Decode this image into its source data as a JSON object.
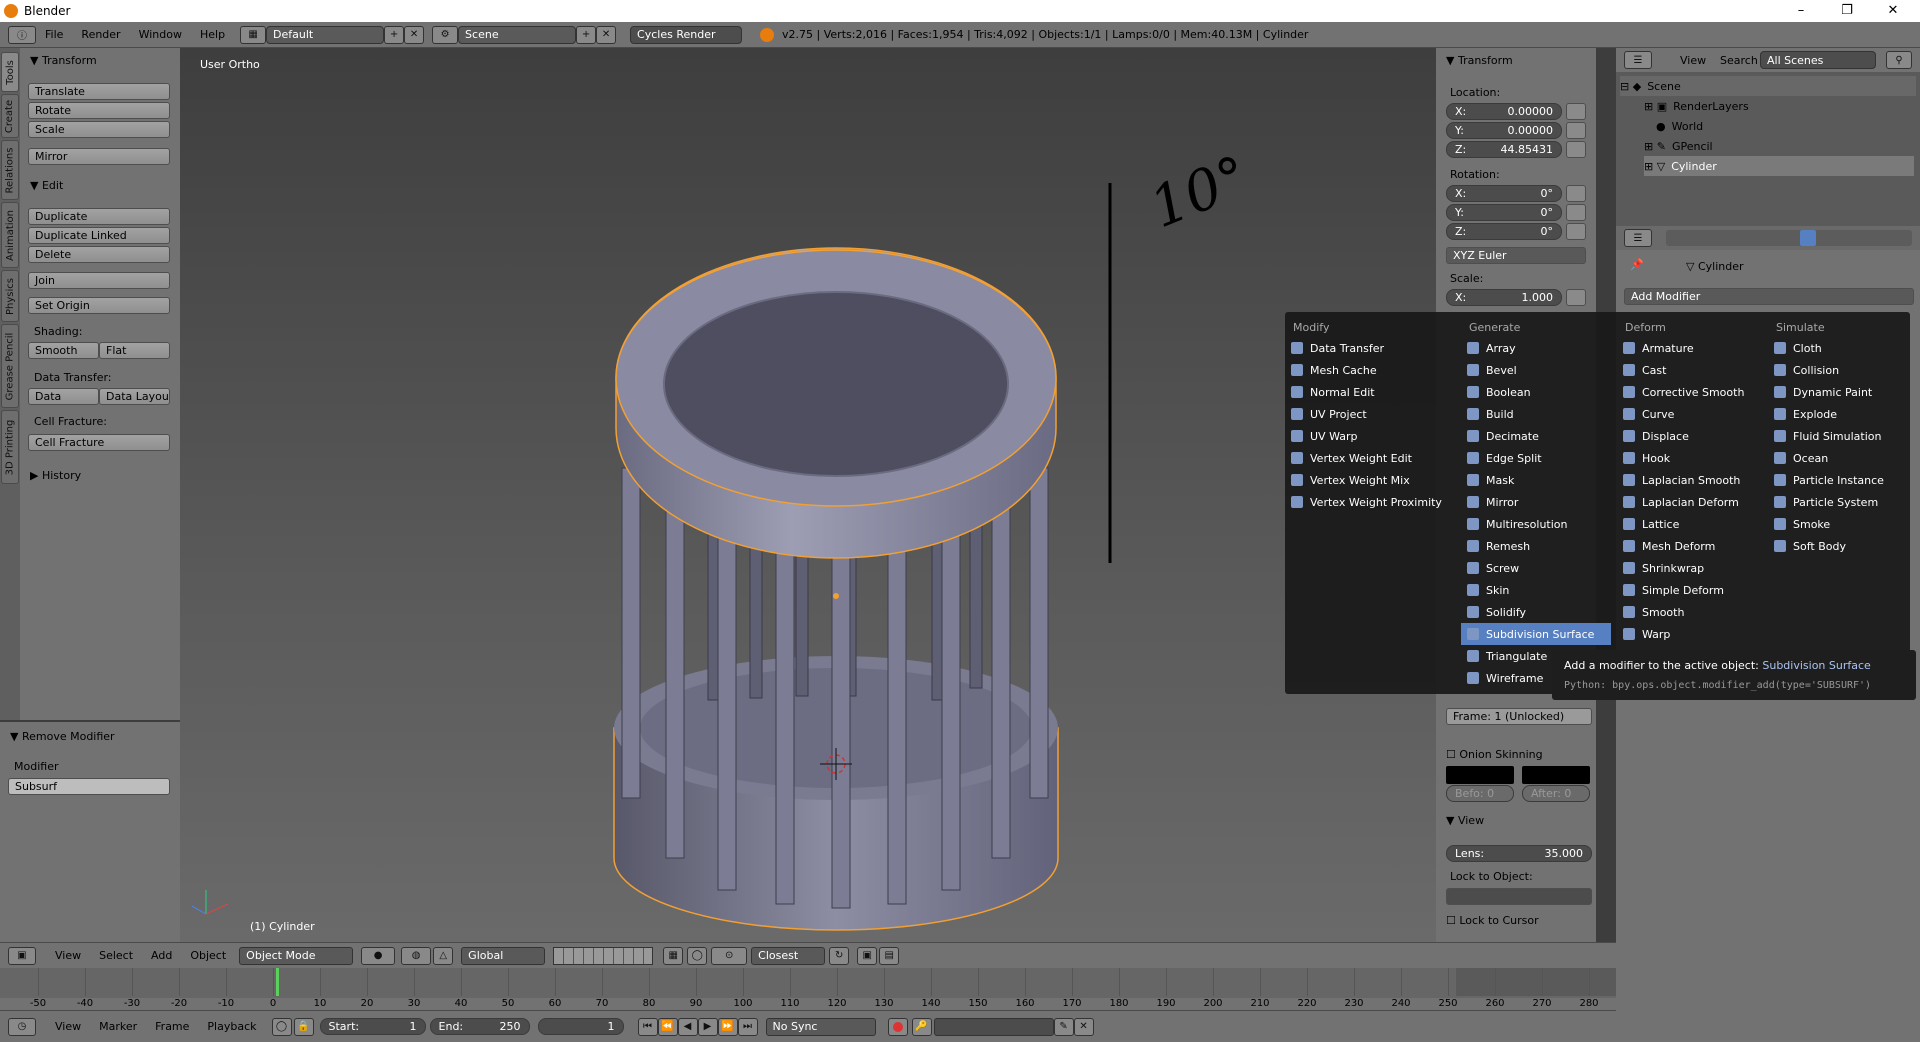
{
  "window": {
    "title": "Blender"
  },
  "topbar": {
    "menus": [
      "File",
      "Render",
      "Window",
      "Help"
    ],
    "layout": "Default",
    "scene": "Scene",
    "engine": "Cycles Render",
    "stats": "v2.75 | Verts:2,016 | Faces:1,954 | Tris:4,092 | Objects:1/1 | Lamps:0/0 | Mem:40.13M | Cylinder"
  },
  "vtabs": [
    "Tools",
    "Create",
    "Relations",
    "Animation",
    "Physics",
    "Grease Pencil",
    "3D Printing"
  ],
  "toolshelf": {
    "transform": {
      "title": "Transform",
      "buttons": [
        "Translate",
        "Rotate",
        "Scale",
        "Mirror"
      ]
    },
    "edit": {
      "title": "Edit",
      "buttons": [
        "Duplicate",
        "Duplicate Linked",
        "Delete",
        "Join",
        "Set Origin"
      ],
      "shading_label": "Shading:",
      "smooth": "Smooth",
      "flat": "Flat",
      "data_transfer_label": "Data Transfer:",
      "data": "Data",
      "data_layout": "Data Layout",
      "cell_fracture_label": "Cell Fracture:",
      "cell_fracture": "Cell Fracture"
    },
    "history": "History"
  },
  "operator": {
    "title": "Remove Modifier",
    "modifier_label": "Modifier",
    "modifier_value": "Subsurf"
  },
  "viewport": {
    "view_name": "User Ortho",
    "object_name": "(1) Cylinder"
  },
  "npanel": {
    "transform": "Transform",
    "location": "Location:",
    "loc": [
      {
        "a": "X:",
        "v": "0.00000"
      },
      {
        "a": "Y:",
        "v": "0.00000"
      },
      {
        "a": "Z:",
        "v": "44.85431"
      }
    ],
    "rotation": "Rotation:",
    "rot": [
      {
        "a": "X:",
        "v": "0°"
      },
      {
        "a": "Y:",
        "v": "0°"
      },
      {
        "a": "Z:",
        "v": "0°"
      }
    ],
    "rot_mode": "XYZ Euler",
    "scale": "Scale:",
    "sc": {
      "a": "X:",
      "v": "1.000"
    },
    "frame": "Frame: 1 (Unlocked)",
    "onion": "Onion Skinning",
    "before": "Befo: 0",
    "after": "After: 0",
    "view": "View",
    "lens_label": "Lens:",
    "lens": "35.000",
    "lock_object": "Lock to Object:",
    "lock_cursor": "Lock to Cursor"
  },
  "outliner": {
    "view": "View",
    "search": "Search",
    "filter": "All Scenes",
    "rows": [
      "Scene",
      "RenderLayers",
      "World",
      "GPencil",
      "Cylinder"
    ]
  },
  "properties": {
    "object": "Cylinder",
    "add_modifier": "Add Modifier"
  },
  "menu": {
    "columns": [
      {
        "head": "Modify",
        "items": [
          "Data Transfer",
          "Mesh Cache",
          "Normal Edit",
          "UV Project",
          "UV Warp",
          "Vertex Weight Edit",
          "Vertex Weight Mix",
          "Vertex Weight Proximity"
        ]
      },
      {
        "head": "Generate",
        "items": [
          "Array",
          "Bevel",
          "Boolean",
          "Build",
          "Decimate",
          "Edge Split",
          "Mask",
          "Mirror",
          "Multiresolution",
          "Remesh",
          "Screw",
          "Skin",
          "Solidify",
          "Subdivision Surface",
          "Triangulate",
          "Wireframe"
        ]
      },
      {
        "head": "Deform",
        "items": [
          "Armature",
          "Cast",
          "Corrective Smooth",
          "Curve",
          "Displace",
          "Hook",
          "Laplacian Smooth",
          "Laplacian Deform",
          "Lattice",
          "Mesh Deform",
          "Shrinkwrap",
          "Simple Deform",
          "Smooth",
          "Warp"
        ]
      },
      {
        "head": "Simulate",
        "items": [
          "Cloth",
          "Collision",
          "Dynamic Paint",
          "Explode",
          "Fluid Simulation",
          "Ocean",
          "Particle Instance",
          "Particle System",
          "Smoke",
          "Soft Body"
        ]
      }
    ],
    "selected": "Subdivision Surface"
  },
  "tooltip": {
    "line1": "Add a modifier to the active object:",
    "line1_value": "Subdivision Surface",
    "line2": "Python: bpy.ops.object.modifier_add(type='SUBSURF')"
  },
  "view3d_header": {
    "view": "View",
    "select": "Select",
    "add": "Add",
    "object": "Object",
    "mode": "Object Mode",
    "orientation": "Global",
    "snap": "Closest"
  },
  "timeline": {
    "ticks": [
      "-50",
      "-40",
      "-30",
      "-20",
      "-10",
      "0",
      "10",
      "20",
      "30",
      "40",
      "50",
      "60",
      "70",
      "80",
      "90",
      "100",
      "110",
      "120",
      "130",
      "140",
      "150",
      "160",
      "170",
      "180",
      "190",
      "200",
      "210",
      "220",
      "230",
      "240",
      "250",
      "260",
      "270",
      "280"
    ],
    "current_frame": "1"
  },
  "timeline_header": {
    "view": "View",
    "marker": "Marker",
    "frame": "Frame",
    "playback": "Playback",
    "start": "Start:",
    "start_val": "1",
    "end": "End:",
    "end_val": "250",
    "sync": "No Sync"
  },
  "annotation": {
    "text": "10°"
  },
  "colors": {
    "panel": "#727272",
    "dark": "#3d3d3d",
    "highlight": "#5680c2",
    "selection": "#f0a030"
  }
}
